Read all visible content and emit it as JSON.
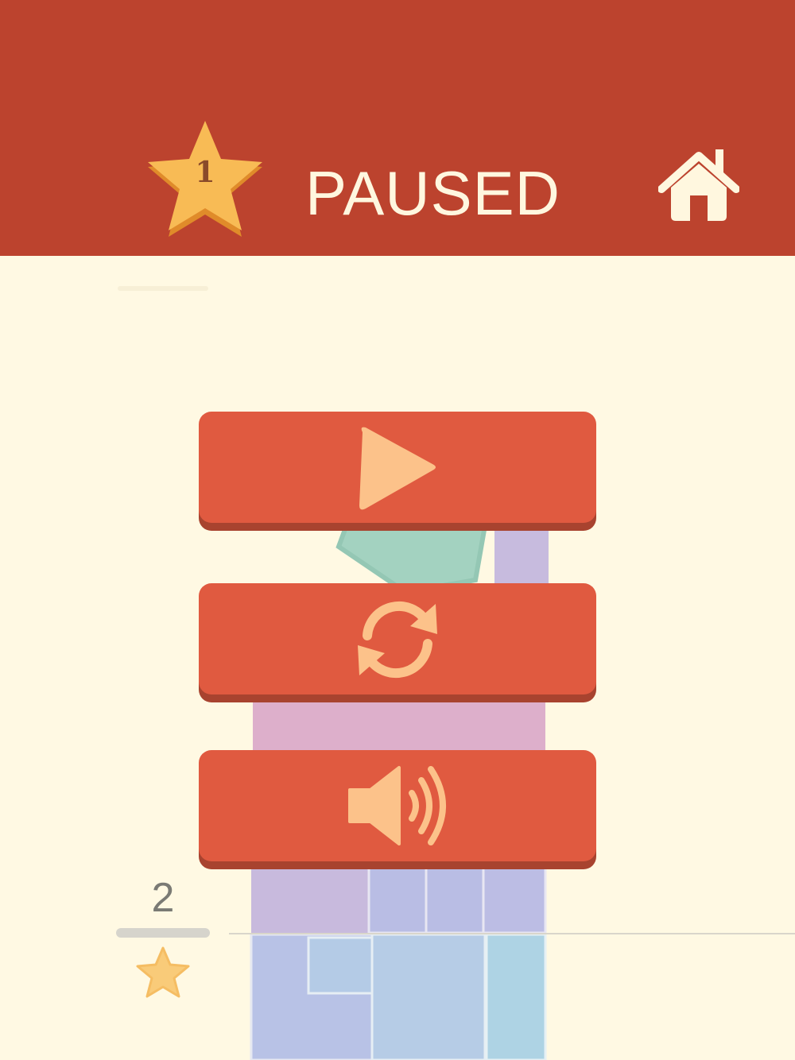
{
  "header": {
    "level_number": "1",
    "title": "PAUSED",
    "home_icon": "home-icon"
  },
  "menu": {
    "buttons": [
      {
        "name": "resume",
        "icon": "play-icon"
      },
      {
        "name": "restart",
        "icon": "refresh-icon"
      },
      {
        "name": "sound",
        "icon": "speaker-icon"
      }
    ]
  },
  "hud": {
    "height_value": "2",
    "star_icon": "star-icon"
  },
  "colors": {
    "header_bg": "#bc432e",
    "page_bg": "#fff9e3",
    "button_bg": "#e05a40",
    "button_shadow": "#a8432f",
    "icon_fill": "#fcc28a",
    "star_fill": "#f7b84f"
  }
}
